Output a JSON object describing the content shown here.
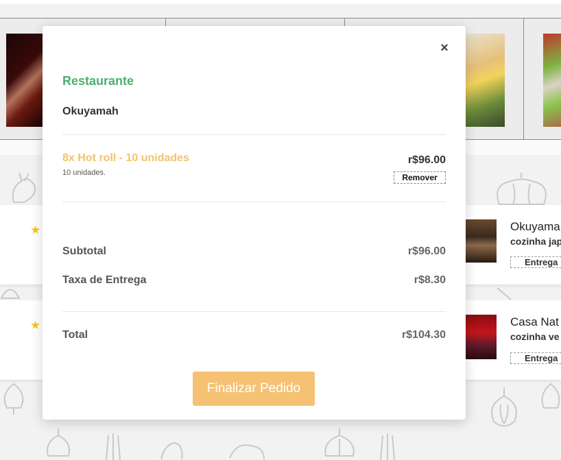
{
  "modal": {
    "close_icon": "×",
    "section_label": "Restaurante",
    "restaurant_name": "Okuyamah",
    "item": {
      "name": "8x Hot roll - 10 unidades",
      "description": "10 unidades.",
      "price": "r$96.00",
      "remove_label": "Remover"
    },
    "summary": {
      "subtotal_label": "Subtotal",
      "subtotal_value": "r$96.00",
      "delivery_label": "Taxa de Entrega",
      "delivery_value": "r$8.30",
      "total_label": "Total",
      "total_value": "r$104.30"
    },
    "checkout_label": "Finalizar Pedido"
  },
  "background_restaurants": [
    {
      "star": "★",
      "name": "Okuyama",
      "cuisine": "cozinha jap",
      "delivery_label": "Entrega"
    },
    {
      "star": "★",
      "name": "Casa Nat",
      "cuisine": "cozinha ve",
      "delivery_label": "Entrega"
    }
  ],
  "colors": {
    "accent_green": "#4caf72",
    "accent_yellow": "#f5c273",
    "item_name": "#f2c36b",
    "star": "#f5c518"
  }
}
